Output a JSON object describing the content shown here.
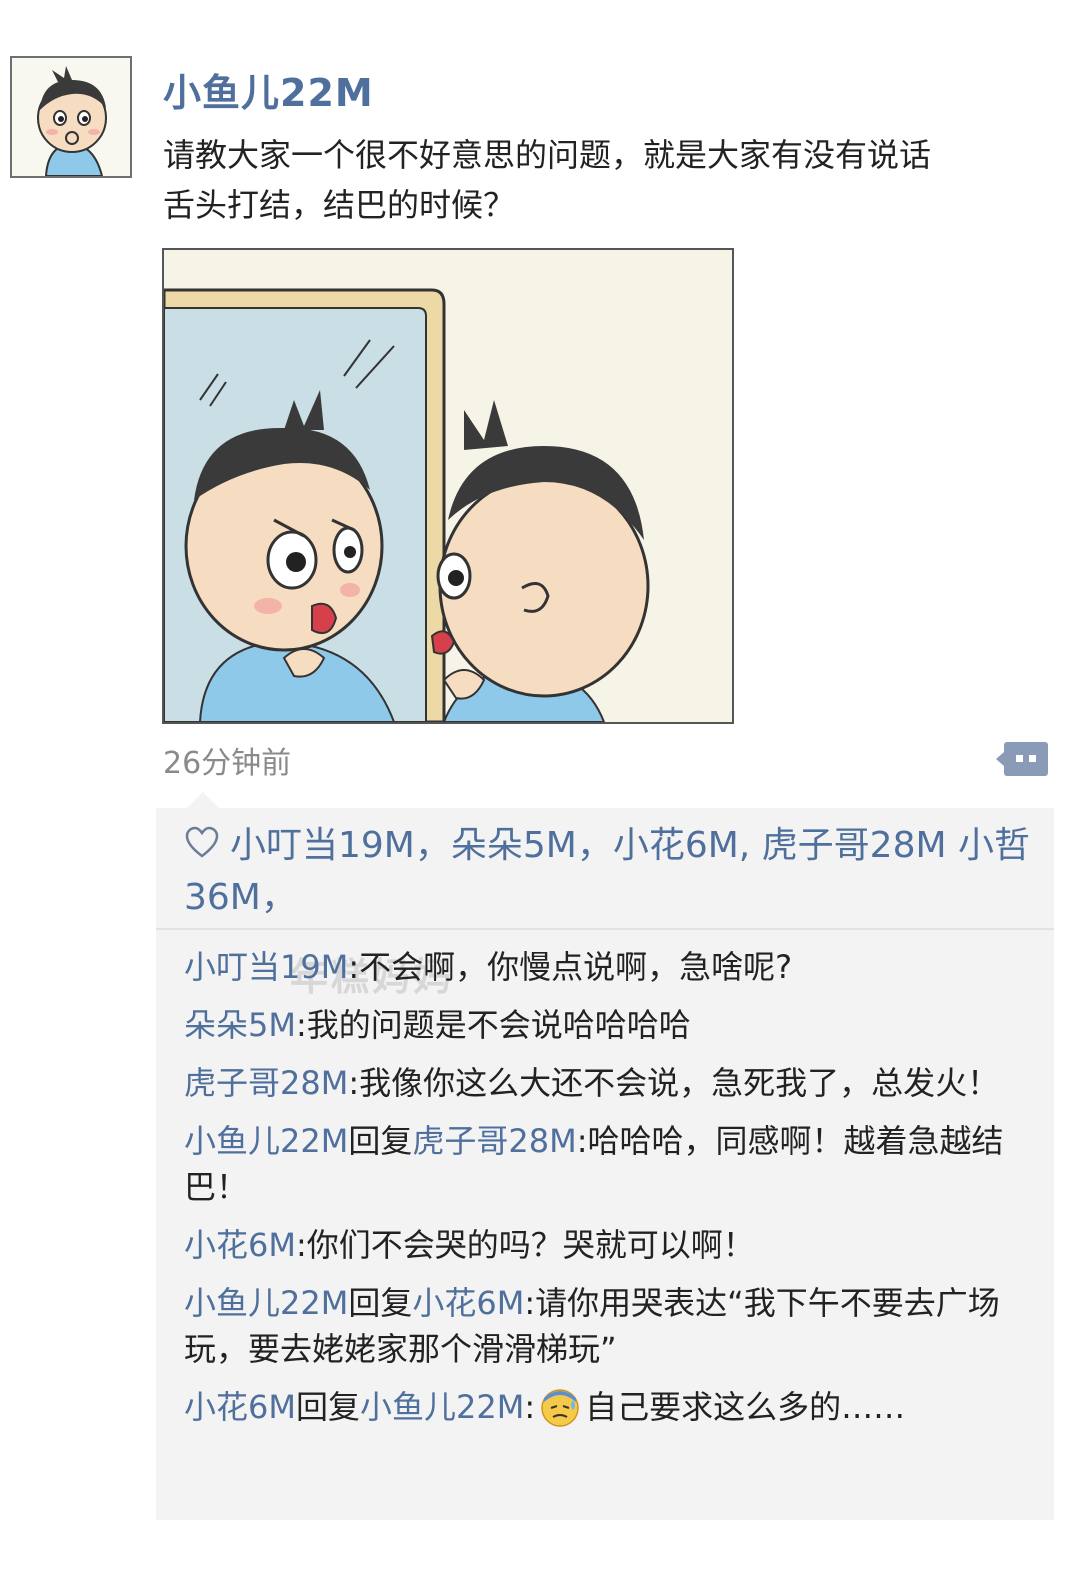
{
  "post": {
    "author": "小鱼儿22M",
    "text": "请教大家一个很不好意思的问题，就是大家有没有说话舌头打结，结巴的时候？",
    "timestamp": "26分钟前"
  },
  "likes": {
    "icon": "heart-icon",
    "names": "小叮当19M，朵朵5M，小花6M, 虎子哥28M 小哲36M，"
  },
  "watermark": "年糕妈妈",
  "comments": [
    {
      "author": "小叮当19M",
      "text": "不会啊，你慢点说啊，急啥呢?"
    },
    {
      "author": "朵朵5M",
      "text": "我的问题是不会说哈哈哈哈"
    },
    {
      "author": "虎子哥28M",
      "text": "我像你这么大还不会说，急死我了，总发火！"
    },
    {
      "author": "小鱼儿22M",
      "reply_word": "回复",
      "reply_to": "虎子哥28M",
      "text": "哈哈哈，同感啊！越着急越结巴！"
    },
    {
      "author": "小花6M",
      "text": "你们不会哭的吗？哭就可以啊！"
    },
    {
      "author": "小鱼儿22M",
      "reply_word": "回复",
      "reply_to": "小花6M",
      "text": "请你用哭表达“我下午不要去广场玩，要去姥姥家那个滑滑梯玩”"
    },
    {
      "author": "小花6M",
      "reply_word": "回复",
      "reply_to": "小鱼儿22M",
      "emoji": "sweat-face-emoji",
      "text": "自己要求这么多的……"
    }
  ],
  "colors": {
    "name": "#4f6f9c",
    "panel": "#f3f3f3",
    "text": "#222222",
    "time": "#8a8a8a"
  }
}
